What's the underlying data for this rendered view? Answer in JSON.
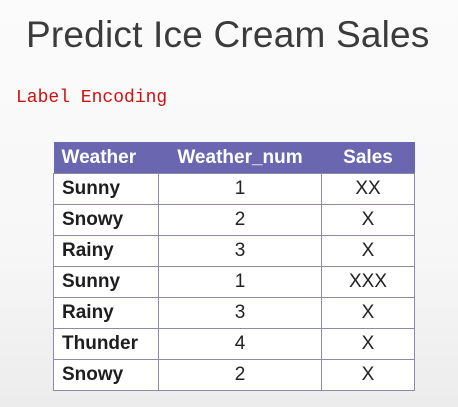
{
  "title": "Predict Ice Cream Sales",
  "subtitle": "Label Encoding",
  "table": {
    "headers": [
      "Weather",
      "Weather_num",
      "Sales"
    ],
    "rows": [
      [
        "Sunny",
        "1",
        "XX"
      ],
      [
        "Snowy",
        "2",
        "X"
      ],
      [
        "Rainy",
        "3",
        "X"
      ],
      [
        "Sunny",
        "1",
        "XXX"
      ],
      [
        "Rainy",
        "3",
        "X"
      ],
      [
        "Thunder",
        "4",
        "X"
      ],
      [
        "Snowy",
        "2",
        "X"
      ]
    ]
  },
  "colors": {
    "header_bg": "#6a67b0",
    "subtitle": "#d01010"
  }
}
